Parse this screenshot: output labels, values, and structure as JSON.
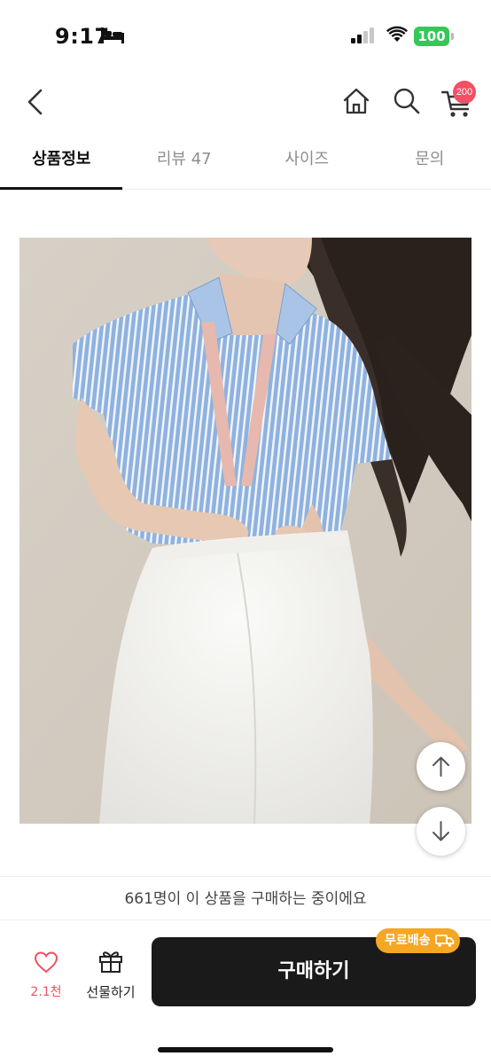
{
  "status_bar": {
    "time": "9:17",
    "battery": "100"
  },
  "cart": {
    "badge": "200"
  },
  "tabs": [
    {
      "label": "상품정보",
      "active": true
    },
    {
      "label": "리뷰 47",
      "active": false
    },
    {
      "label": "사이즈",
      "active": false
    },
    {
      "label": "문의",
      "active": false
    }
  ],
  "purchase_notice": "661명이 이 상품을 구매하는 중이에요",
  "bottom_bar": {
    "like_count": "2.1천",
    "gift_label": "선물하기",
    "buy_label": "구매하기",
    "free_shipping_label": "무료배송"
  },
  "colors": {
    "accent": "#f25064",
    "badge_orange": "#f5a623",
    "buy_button": "#1a1a1a",
    "battery": "#34c759"
  }
}
